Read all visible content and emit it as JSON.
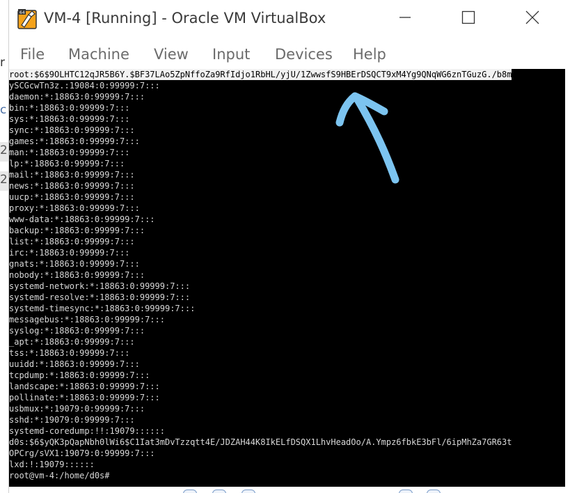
{
  "window": {
    "title": "VM-4 [Running] - Oracle VM VirtualBox",
    "app_icon": "virtualbox-icon",
    "controls": [
      "minimize-icon",
      "maximize-icon",
      "close-icon"
    ]
  },
  "menu": {
    "items": [
      "File",
      "Machine",
      "View",
      "Input",
      "Devices",
      "Help"
    ]
  },
  "background": {
    "mark_a": "r",
    "mark_b": "c",
    "num_one": "2",
    "num_two": "2"
  },
  "console": {
    "lines": [
      "root:$6$9OLHTC12qJR5B6Y.$BF37LAo5ZpNffoZa9RfIdjo1RbHL/yjU/1ZwwsfS9HBErDSQCT9xM4Yg9QNqWG6znTGuzG./b8m",
      "ySCGcwTn3z.:19084:0:99999:7:::",
      "daemon:*:18863:0:99999:7:::",
      "bin:*:18863:0:99999:7:::",
      "sys:*:18863:0:99999:7:::",
      "sync:*:18863:0:99999:7:::",
      "games:*:18863:0:99999:7:::",
      "man:*:18863:0:99999:7:::",
      "lp:*:18863:0:99999:7:::",
      "mail:*:18863:0:99999:7:::",
      "news:*:18863:0:99999:7:::",
      "uucp:*:18863:0:99999:7:::",
      "proxy:*:18863:0:99999:7:::",
      "www-data:*:18863:0:99999:7:::",
      "backup:*:18863:0:99999:7:::",
      "list:*:18863:0:99999:7:::",
      "irc:*:18863:0:99999:7:::",
      "gnats:*:18863:0:99999:7:::",
      "nobody:*:18863:0:99999:7:::",
      "systemd-network:*:18863:0:99999:7:::",
      "systemd-resolve:*:18863:0:99999:7:::",
      "systemd-timesync:*:18863:0:99999:7:::",
      "messagebus:*:18863:0:99999:7:::",
      "syslog:*:18863:0:99999:7:::",
      "_apt:*:18863:0:99999:7:::",
      "tss:*:18863:0:99999:7:::",
      "uuidd:*:18863:0:99999:7:::",
      "tcpdump:*:18863:0:99999:7:::",
      "landscape:*:18863:0:99999:7:::",
      "pollinate:*:18863:0:99999:7:::",
      "usbmux:*:19079:0:99999:7:::",
      "sshd:*:19079:0:99999:7:::",
      "systemd-coredump:!!:19079::::::",
      "d0s:$6$yQK3pQapNbh0lWi6$C1Iat3mDvTzzqtt4E/JDZAH44K8IkELfDSQX1LhvHeadOo/A.Ympz6fbkE3bFl/6ipMhZa7GR63t",
      "OPCrg/sVX1:19079:0:99999:7:::",
      "lxd:!:19079::::::",
      "root@vm-4:/home/d0s#"
    ],
    "highlight_line": 0,
    "background": "#000000",
    "text_color": "#d8d8d8"
  },
  "annotation": {
    "arrow_color": "#7cc4f0",
    "arrow_icon": "hand-drawn-arrow-icon"
  },
  "statusbar": {
    "icons": [
      "network-icon",
      "usb-icon",
      "shared-folder-icon",
      "display-icon",
      "capture-icon"
    ]
  }
}
